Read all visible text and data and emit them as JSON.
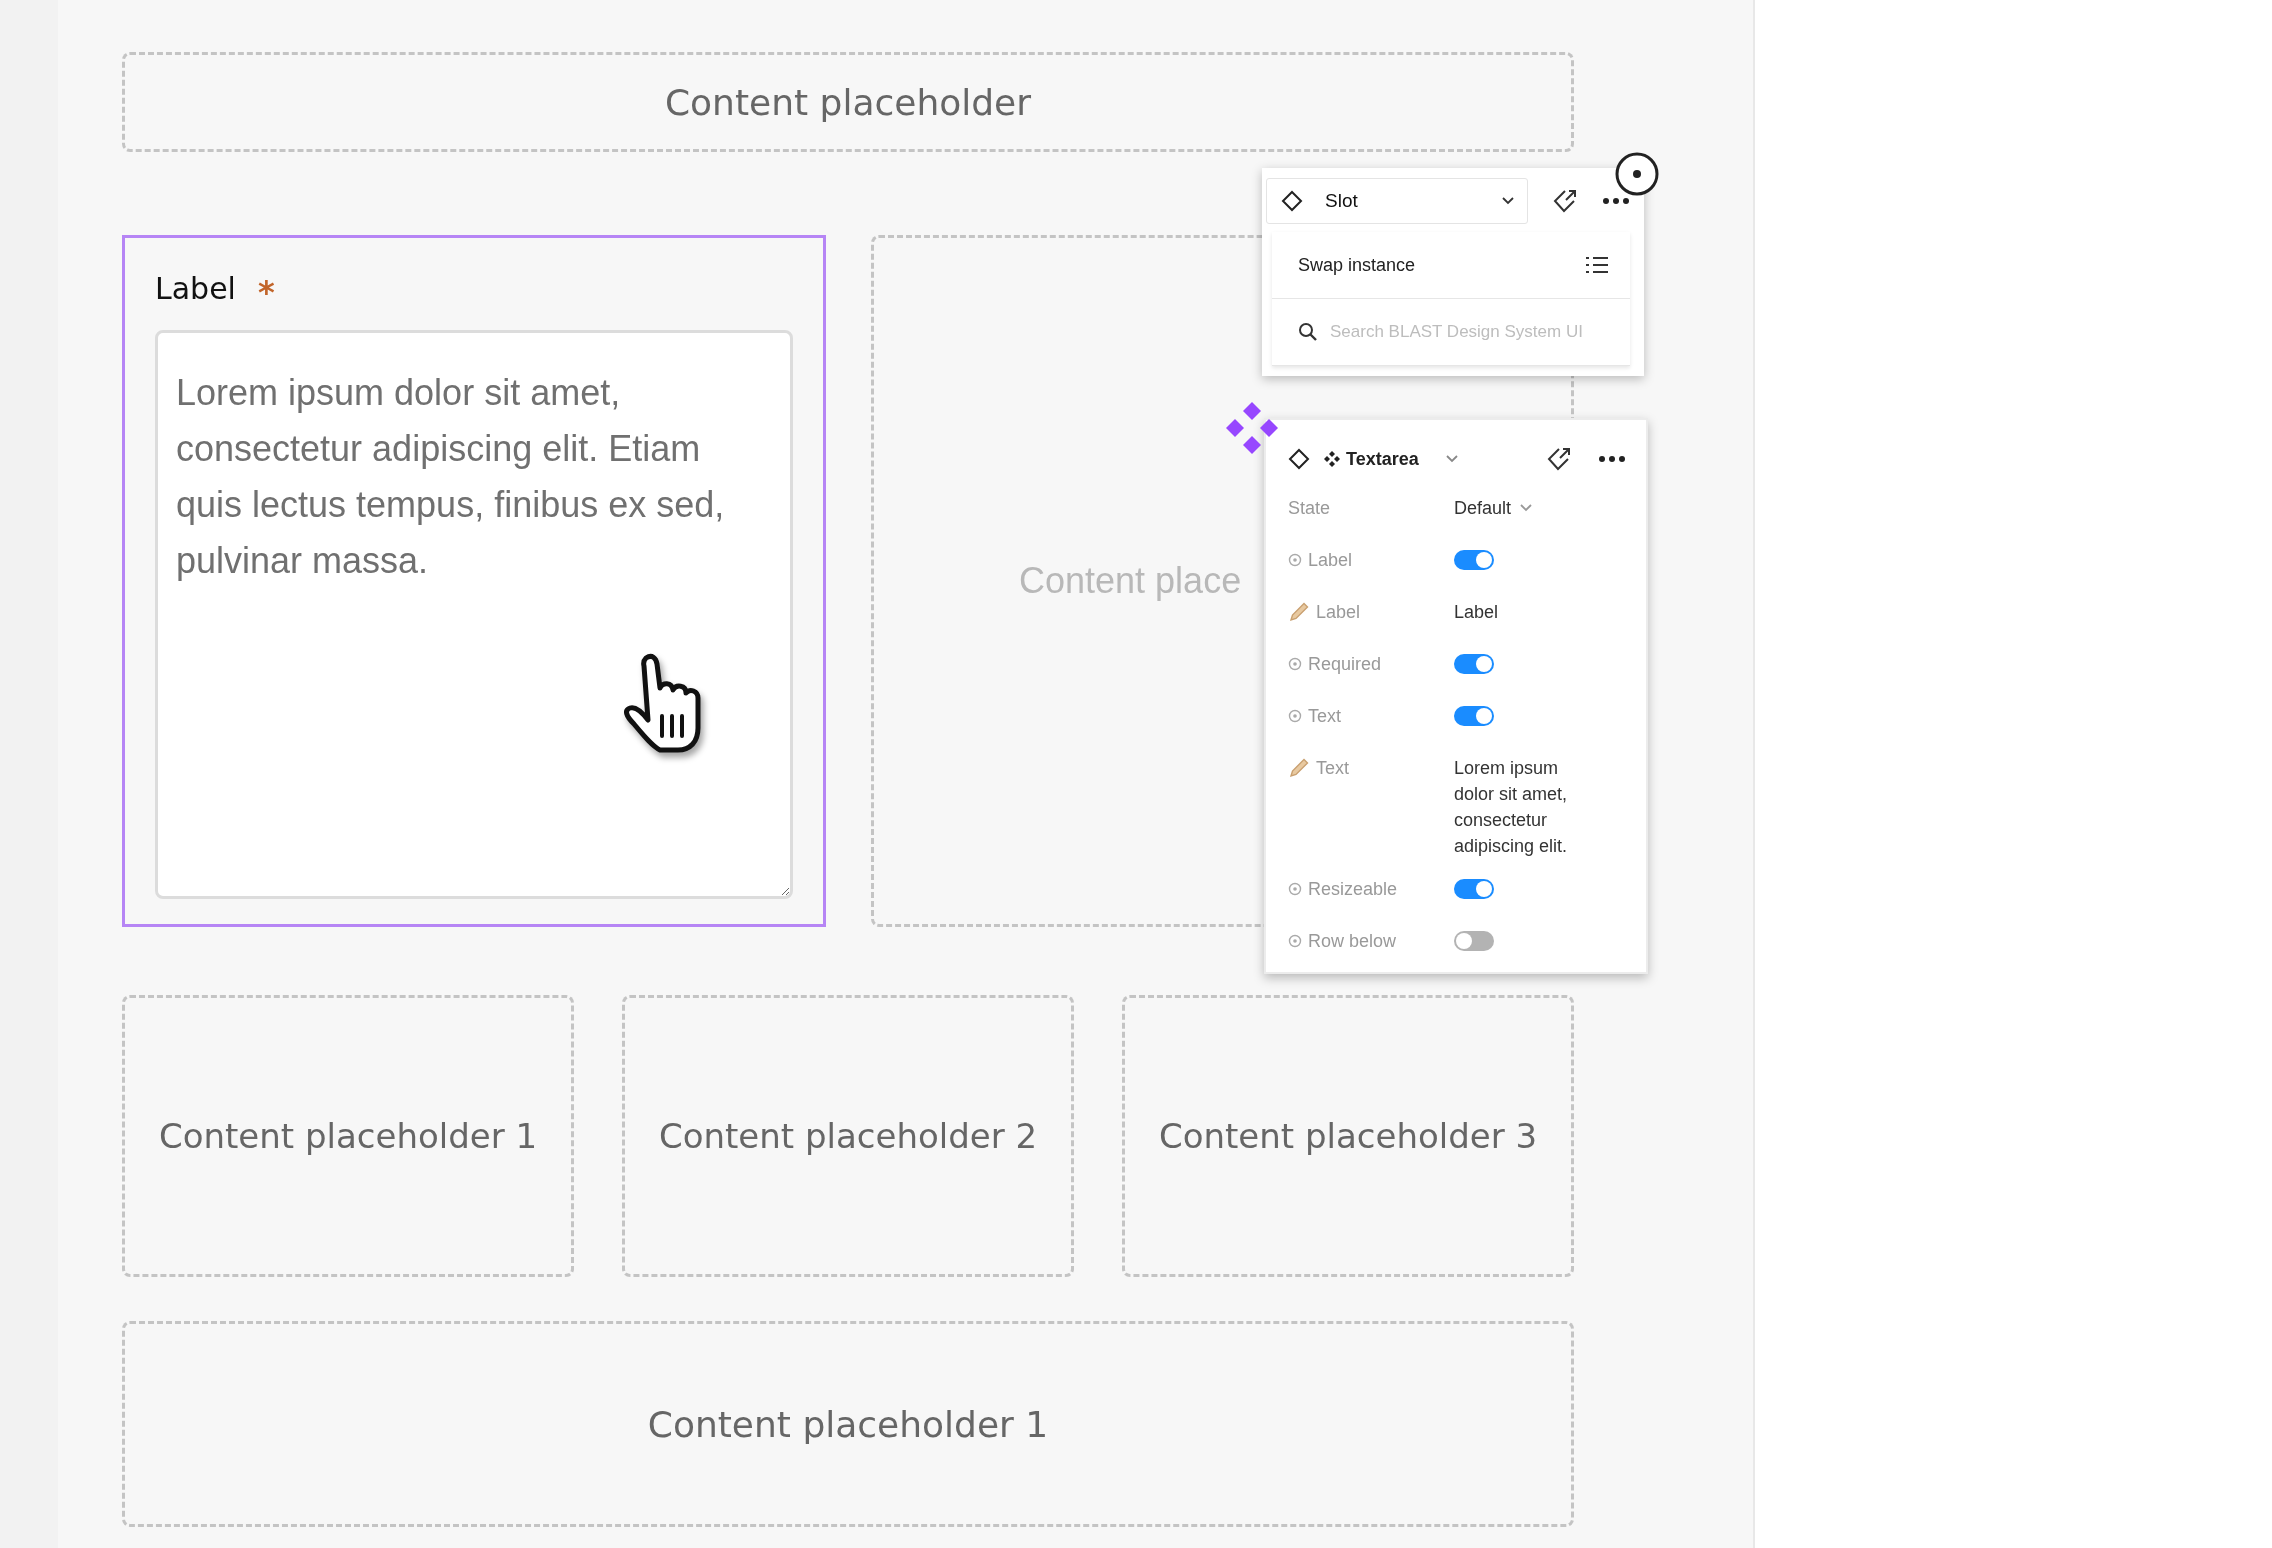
{
  "top_placeholder": {
    "text": "Content placeholder"
  },
  "textarea_field": {
    "label": "Label",
    "required_mark": "*",
    "value": "Lorem ipsum dolor sit amet, consectetur adipiscing elit. Etiam quis lectus tempus, finibus ex sed, pulvinar massa.",
    "selected": true
  },
  "slot_placeholder": {
    "text": "Content place"
  },
  "row_placeholders": [
    {
      "text": "Content placeholder 1"
    },
    {
      "text": "Content placeholder 2"
    },
    {
      "text": "Content placeholder 3"
    }
  ],
  "bottom_placeholder": {
    "text": "Content placeholder 1"
  },
  "slot_panel": {
    "title": "Slot",
    "menu_title": "Swap instance",
    "search": {
      "placeholder": "Search BLAST Design System UI"
    }
  },
  "props_panel": {
    "component": "Textarea",
    "properties": [
      {
        "kind": "variant",
        "name": "State",
        "value": "Default"
      },
      {
        "kind": "toggle",
        "name": "Label",
        "on": true
      },
      {
        "kind": "text",
        "name": "Label",
        "value": "Label"
      },
      {
        "kind": "toggle",
        "name": "Required",
        "on": true
      },
      {
        "kind": "toggle",
        "name": "Text",
        "on": true
      },
      {
        "kind": "text",
        "name": "Text",
        "value": "Lorem ipsum dolor sit amet, consectetur adipiscing elit."
      },
      {
        "kind": "toggle",
        "name": "Resizeable",
        "on": true
      },
      {
        "kind": "toggle",
        "name": "Row below",
        "on": false
      }
    ]
  }
}
